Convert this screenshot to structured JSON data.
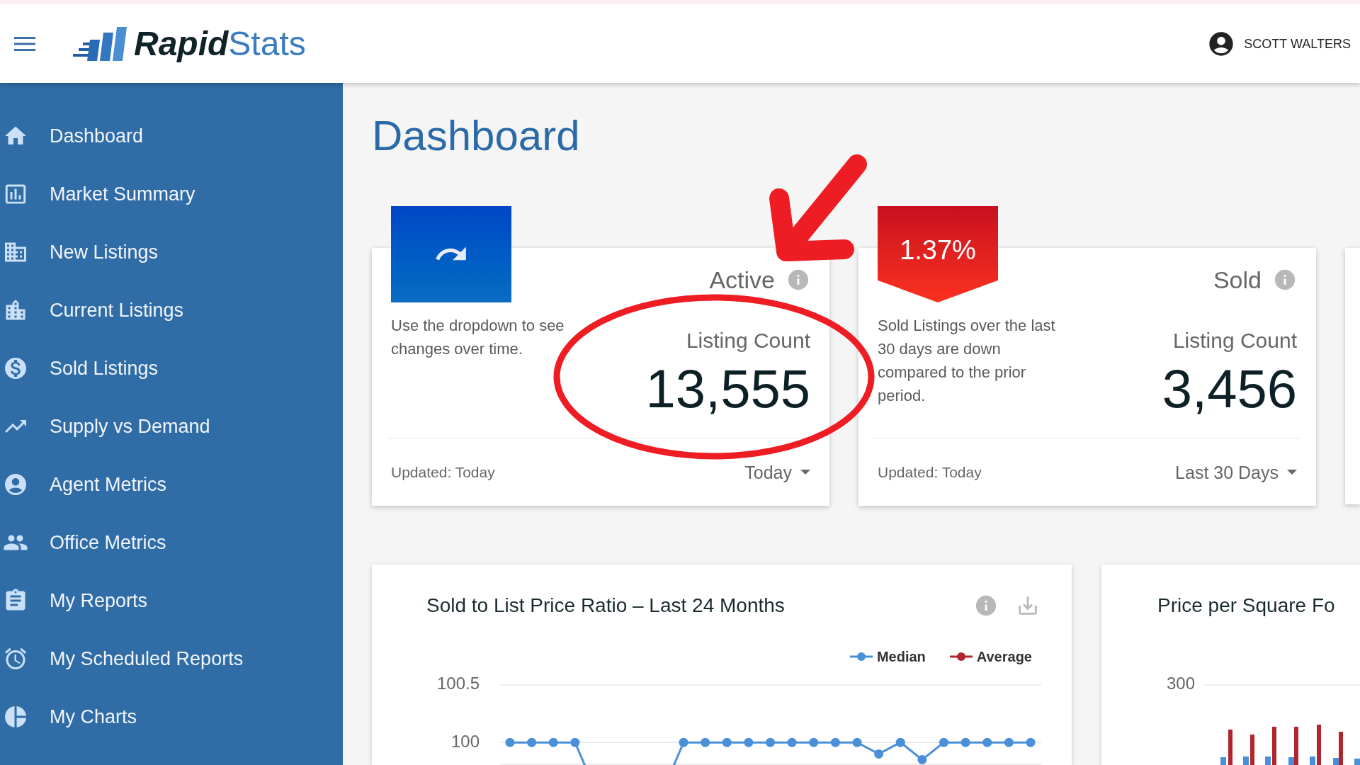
{
  "header": {
    "brand": "**Rapid**Stats",
    "user": "SCOTT WALTERS"
  },
  "sidebar": {
    "items": [
      "Dashboard",
      "Market Summary",
      "New Listings",
      "Current Listings",
      "Sold Listings",
      "Supply vs Demand",
      "Agent Metrics",
      "Office Metrics",
      "My Reports",
      "My Scheduled Reports",
      "My Charts"
    ]
  },
  "page_title": "Dashboard",
  "cards": [
    {
      "kind": "icon_tile",
      "title": "Active",
      "description": "Use the dropdown to see changes over time.",
      "metric_label": "Listing Count",
      "value": "13,555",
      "updated": "Updated: Today",
      "period": "Today"
    },
    {
      "kind": "percent_badge",
      "badge": "1.37%",
      "title": "Sold",
      "description": "Sold Listings over the last 30 days are down compared to the prior period.",
      "metric_label": "Listing Count",
      "value": "3,456",
      "updated": "Updated: Today",
      "period": "Last 30 Days"
    }
  ],
  "charts": [
    {
      "title": "Sold to List Price Ratio – Last 24 Months",
      "chart_data": {
        "type": "line",
        "series": [
          {
            "name": "Median",
            "color": "#4a90d9",
            "marker": "circle",
            "values": [
              100,
              100,
              100,
              100,
              null,
              null,
              null,
              null,
              100,
              100,
              100,
              100,
              100,
              100,
              100,
              100,
              100,
              99.9,
              100,
              99.85,
              100,
              100,
              100,
              100,
              100
            ]
          },
          {
            "name": "Average",
            "color": "#b0262c",
            "marker": "circle"
          }
        ],
        "ylim": [
          99.81,
          100.5
        ],
        "yticks": [
          100,
          100.5
        ]
      }
    },
    {
      "title": "Price per Square Fo",
      "y_tick_labels": [
        "300"
      ]
    }
  ]
}
